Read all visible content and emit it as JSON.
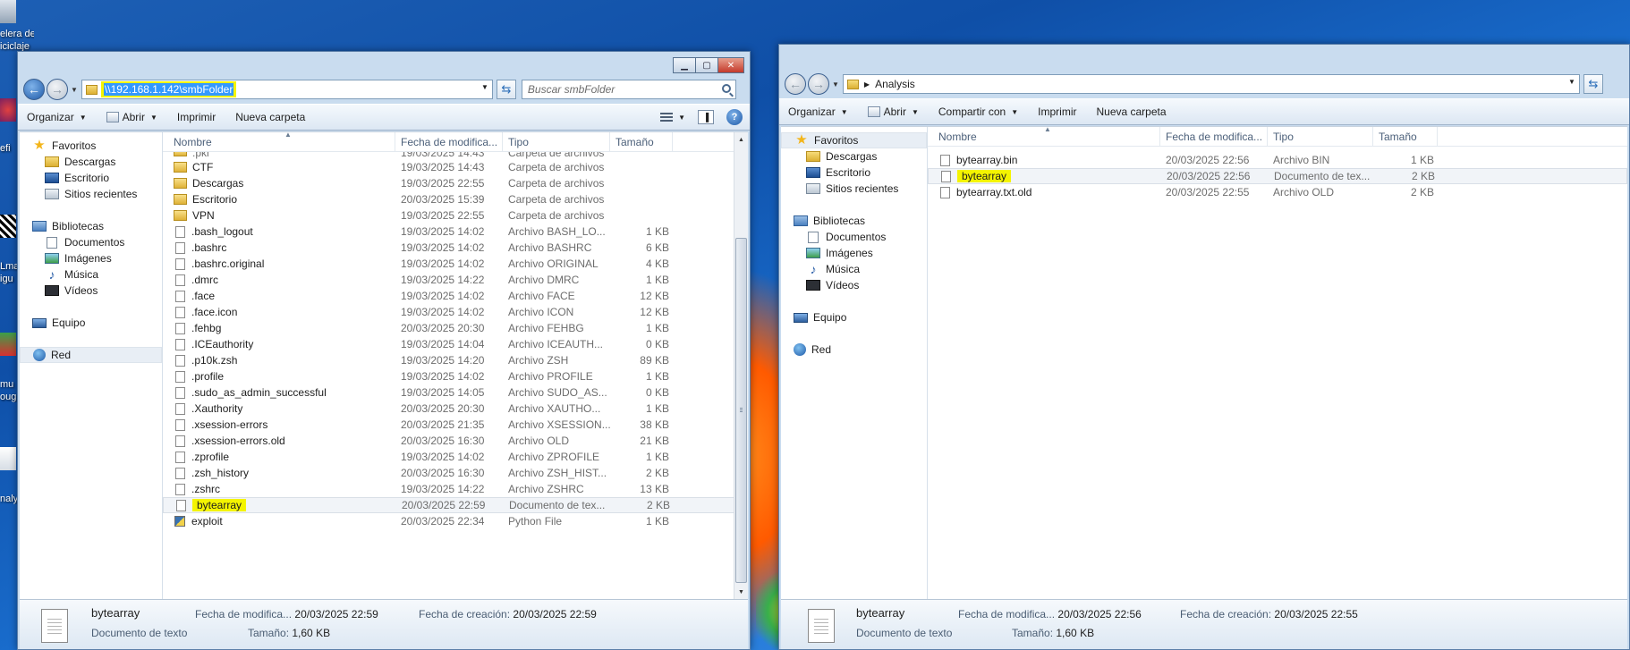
{
  "desktop": {
    "labels": [
      "elera de",
      "iciclaje",
      "efi",
      "Lma",
      "igu",
      "mu",
      "oug",
      "naly"
    ]
  },
  "left_window": {
    "address": "\\\\192.168.1.142\\smbFolder",
    "search_placeholder": "Buscar smbFolder",
    "toolbar": {
      "organize": "Organizar",
      "open": "Abrir",
      "print": "Imprimir",
      "new_folder": "Nueva carpeta"
    },
    "nav": {
      "favorites": "Favoritos",
      "downloads": "Descargas",
      "desktop": "Escritorio",
      "recent": "Sitios recientes",
      "libraries": "Bibliotecas",
      "documents": "Documentos",
      "images": "Imágenes",
      "music": "Música",
      "videos": "Vídeos",
      "computer": "Equipo",
      "network": "Red"
    },
    "columns": {
      "name": "Nombre",
      "date": "Fecha de modifica...",
      "type": "Tipo",
      "size": "Tamaño"
    },
    "partial_row": {
      "name": ".pki",
      "date": "19/03/2025 14:43",
      "type": "Carpeta de archivos"
    },
    "files": [
      {
        "name": "CTF",
        "date": "19/03/2025 14:43",
        "type": "Carpeta de archivos",
        "size": "",
        "kind": "folder"
      },
      {
        "name": "Descargas",
        "date": "19/03/2025 22:55",
        "type": "Carpeta de archivos",
        "size": "",
        "kind": "folder"
      },
      {
        "name": "Escritorio",
        "date": "20/03/2025 15:39",
        "type": "Carpeta de archivos",
        "size": "",
        "kind": "folder"
      },
      {
        "name": "VPN",
        "date": "19/03/2025 22:55",
        "type": "Carpeta de archivos",
        "size": "",
        "kind": "folder"
      },
      {
        "name": ".bash_logout",
        "date": "19/03/2025 14:02",
        "type": "Archivo BASH_LO...",
        "size": "1 KB",
        "kind": "file"
      },
      {
        "name": ".bashrc",
        "date": "19/03/2025 14:02",
        "type": "Archivo BASHRC",
        "size": "6 KB",
        "kind": "file"
      },
      {
        "name": ".bashrc.original",
        "date": "19/03/2025 14:02",
        "type": "Archivo ORIGINAL",
        "size": "4 KB",
        "kind": "file"
      },
      {
        "name": ".dmrc",
        "date": "19/03/2025 14:22",
        "type": "Archivo DMRC",
        "size": "1 KB",
        "kind": "file"
      },
      {
        "name": ".face",
        "date": "19/03/2025 14:02",
        "type": "Archivo FACE",
        "size": "12 KB",
        "kind": "file"
      },
      {
        "name": ".face.icon",
        "date": "19/03/2025 14:02",
        "type": "Archivo ICON",
        "size": "12 KB",
        "kind": "file"
      },
      {
        "name": ".fehbg",
        "date": "20/03/2025 20:30",
        "type": "Archivo FEHBG",
        "size": "1 KB",
        "kind": "file"
      },
      {
        "name": ".ICEauthority",
        "date": "19/03/2025 14:04",
        "type": "Archivo ICEAUTH...",
        "size": "0 KB",
        "kind": "file"
      },
      {
        "name": ".p10k.zsh",
        "date": "19/03/2025 14:20",
        "type": "Archivo ZSH",
        "size": "89 KB",
        "kind": "file"
      },
      {
        "name": ".profile",
        "date": "19/03/2025 14:02",
        "type": "Archivo PROFILE",
        "size": "1 KB",
        "kind": "file"
      },
      {
        "name": ".sudo_as_admin_successful",
        "date": "19/03/2025 14:05",
        "type": "Archivo SUDO_AS...",
        "size": "0 KB",
        "kind": "file"
      },
      {
        "name": ".Xauthority",
        "date": "20/03/2025 20:30",
        "type": "Archivo XAUTHO...",
        "size": "1 KB",
        "kind": "file"
      },
      {
        "name": ".xsession-errors",
        "date": "20/03/2025 21:35",
        "type": "Archivo XSESSION...",
        "size": "38 KB",
        "kind": "file"
      },
      {
        "name": ".xsession-errors.old",
        "date": "20/03/2025 16:30",
        "type": "Archivo OLD",
        "size": "21 KB",
        "kind": "file"
      },
      {
        "name": ".zprofile",
        "date": "19/03/2025 14:02",
        "type": "Archivo ZPROFILE",
        "size": "1 KB",
        "kind": "file"
      },
      {
        "name": ".zsh_history",
        "date": "20/03/2025 16:30",
        "type": "Archivo ZSH_HIST...",
        "size": "2 KB",
        "kind": "file"
      },
      {
        "name": ".zshrc",
        "date": "19/03/2025 14:22",
        "type": "Archivo ZSHRC",
        "size": "13 KB",
        "kind": "file"
      },
      {
        "name": "bytearray",
        "date": "20/03/2025 22:59",
        "type": "Documento de tex...",
        "size": "2 KB",
        "kind": "file",
        "selected": true,
        "highlight": true
      },
      {
        "name": "exploit",
        "date": "20/03/2025 22:34",
        "type": "Python File",
        "size": "1 KB",
        "kind": "py"
      }
    ],
    "details": {
      "name": "bytearray",
      "type": "Documento de texto",
      "modified_label": "Fecha de modifica...",
      "modified_value": "20/03/2025 22:59",
      "created_label": "Fecha de creación:",
      "created_value": "20/03/2025 22:59",
      "size_label": "Tamaño:",
      "size_value": "1,60 KB"
    }
  },
  "right_window": {
    "breadcrumb": "Analysis",
    "toolbar": {
      "organize": "Organizar",
      "open": "Abrir",
      "share": "Compartir con",
      "print": "Imprimir",
      "new_folder": "Nueva carpeta"
    },
    "nav": {
      "favorites": "Favoritos",
      "downloads": "Descargas",
      "desktop": "Escritorio",
      "recent": "Sitios recientes",
      "libraries": "Bibliotecas",
      "documents": "Documentos",
      "images": "Imágenes",
      "music": "Música",
      "videos": "Vídeos",
      "computer": "Equipo",
      "network": "Red"
    },
    "columns": {
      "name": "Nombre",
      "date": "Fecha de modifica...",
      "type": "Tipo",
      "size": "Tamaño"
    },
    "files": [
      {
        "name": "bytearray.bin",
        "date": "20/03/2025 22:56",
        "type": "Archivo BIN",
        "size": "1 KB",
        "kind": "file"
      },
      {
        "name": "bytearray",
        "date": "20/03/2025 22:56",
        "type": "Documento de tex...",
        "size": "2 KB",
        "kind": "file",
        "selected": true,
        "highlight": true
      },
      {
        "name": "bytearray.txt.old",
        "date": "20/03/2025 22:55",
        "type": "Archivo OLD",
        "size": "2 KB",
        "kind": "file"
      }
    ],
    "details": {
      "name": "bytearray",
      "type": "Documento de texto",
      "modified_label": "Fecha de modifica...",
      "modified_value": "20/03/2025 22:56",
      "created_label": "Fecha de creación:",
      "created_value": "20/03/2025 22:55",
      "size_label": "Tamaño:",
      "size_value": "1,60 KB"
    }
  },
  "colors": {
    "highlight_yellow": "#f4f400",
    "selection_blue": "#3399ff",
    "window_frame": "#c9dcef",
    "desktop_blue": "#1d5fb4"
  }
}
